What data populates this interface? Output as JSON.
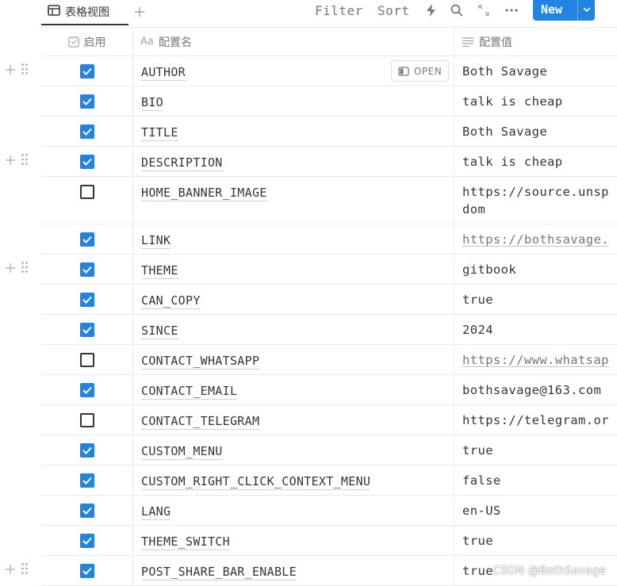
{
  "toolbar": {
    "view_name": "表格视图",
    "filter_label": "Filter",
    "sort_label": "Sort",
    "new_label": "New"
  },
  "columns": [
    {
      "label": "启用",
      "icon": "checkbox-icon"
    },
    {
      "label": "配置名",
      "icon": "title-aa-icon"
    },
    {
      "label": "配置值",
      "icon": "text-lines-icon"
    }
  ],
  "open_label": "OPEN",
  "rows": [
    {
      "enabled": true,
      "name": "AUTHOR",
      "value": "Both Savage",
      "link": false
    },
    {
      "enabled": true,
      "name": "BIO",
      "value": "talk is cheap",
      "link": false
    },
    {
      "enabled": true,
      "name": "TITLE",
      "value": "Both Savage",
      "link": false
    },
    {
      "enabled": true,
      "name": "DESCRIPTION",
      "value": "talk is cheap",
      "link": false
    },
    {
      "enabled": false,
      "name": "HOME_BANNER_IMAGE",
      "value": "https://source.unsp\ndom",
      "link": false
    },
    {
      "enabled": true,
      "name": "LINK",
      "value": "https://bothsavage.",
      "link": true
    },
    {
      "enabled": true,
      "name": "THEME",
      "value": "gitbook",
      "link": false
    },
    {
      "enabled": true,
      "name": "CAN_COPY",
      "value": "true",
      "link": false
    },
    {
      "enabled": true,
      "name": "SINCE",
      "value": "2024",
      "link": false
    },
    {
      "enabled": false,
      "name": "CONTACT_WHATSAPP",
      "value": "https://www.whatsap",
      "link": true
    },
    {
      "enabled": true,
      "name": "CONTACT_EMAIL",
      "value": "bothsavage@163.com",
      "link": false
    },
    {
      "enabled": false,
      "name": "CONTACT_TELEGRAM",
      "value": "https://telegram.or",
      "link": false
    },
    {
      "enabled": true,
      "name": "CUSTOM_MENU",
      "value": "true",
      "link": false
    },
    {
      "enabled": true,
      "name": "CUSTOM_RIGHT_CLICK_CONTEXT_MENU",
      "value": "false",
      "link": false
    },
    {
      "enabled": true,
      "name": "LANG",
      "value": "en-US",
      "link": false
    },
    {
      "enabled": true,
      "name": "THEME_SWITCH",
      "value": "true",
      "link": false
    },
    {
      "enabled": true,
      "name": "POST_SHARE_BAR_ENABLE",
      "value": "true",
      "link": false
    }
  ],
  "watermark": "CSDN @BothSavage",
  "colors": {
    "accent": "#2383e2",
    "text": "#37352f",
    "muted": "#787774",
    "border": "#e9e9e7"
  }
}
